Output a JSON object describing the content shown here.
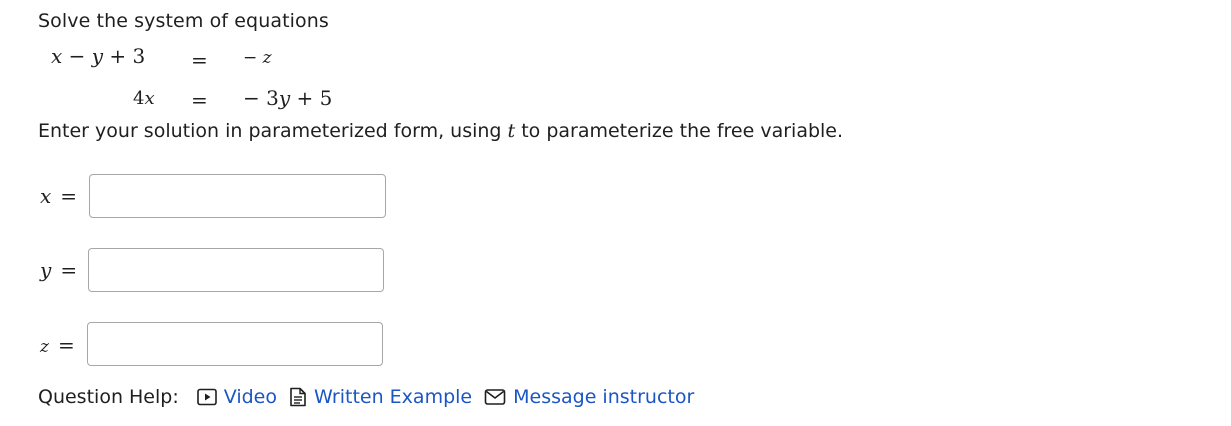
{
  "question": {
    "prompt": "Solve the system of equations",
    "equations": [
      {
        "lhs_parts": [
          "x",
          " − ",
          "y",
          " + 3"
        ],
        "sign": "=",
        "rhs_parts": [
          "− ",
          "z"
        ]
      },
      {
        "lhs_parts": [
          "4",
          "x"
        ],
        "sign": "=",
        "rhs_parts": [
          "− 3",
          "y",
          " + 5"
        ]
      }
    ],
    "instruction_before": "Enter your solution in parameterized form, using ",
    "instruction_param": "t",
    "instruction_after": " to parameterize the free variable."
  },
  "answers": [
    {
      "var": "x",
      "sign": "=",
      "value": "",
      "placeholder": ""
    },
    {
      "var": "y",
      "sign": "=",
      "value": "",
      "placeholder": ""
    },
    {
      "var": "z",
      "sign": "=",
      "value": "",
      "placeholder": ""
    }
  ],
  "help": {
    "label": "Question Help:",
    "links": [
      {
        "label": "Video",
        "icon": "video-icon"
      },
      {
        "label": "Written Example",
        "icon": "document-icon"
      },
      {
        "label": "Message instructor",
        "icon": "mail-icon"
      }
    ],
    "link_color": "#1a56c4"
  }
}
